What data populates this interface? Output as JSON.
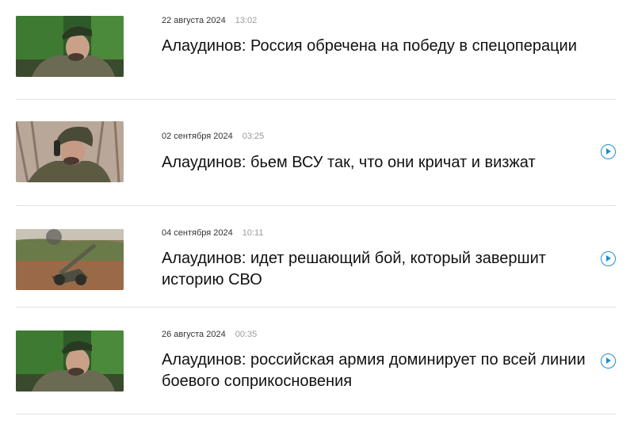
{
  "feed": {
    "items": [
      {
        "date": "22 августа 2024",
        "time": "13:02",
        "title": "Алаудинов: Россия обречена на победу в спецоперации",
        "has_video": false,
        "image_icon": "soldier-beret-photo"
      },
      {
        "date": "02 сентября 2024",
        "time": "03:25",
        "title": "Алаудинов: бьем ВСУ так, что они кричат и визжат",
        "has_video": true,
        "image_icon": "soldier-helmet-photo"
      },
      {
        "date": "04 сентября 2024",
        "time": "10:11",
        "title": "Алаудинов: идет решающий бой, который завершит историю СВО",
        "has_video": true,
        "image_icon": "artillery-howitzer-photo"
      },
      {
        "date": "26 августа 2024",
        "time": "00:35",
        "title": "Алаудинов: российская армия доминирует по всей линии боевого соприкосновения",
        "has_video": true,
        "image_icon": "soldier-beret-photo"
      }
    ]
  },
  "colors": {
    "accent": "#1e8ed0",
    "divider": "#e2e2e2",
    "time_text": "#9a9a9a"
  }
}
